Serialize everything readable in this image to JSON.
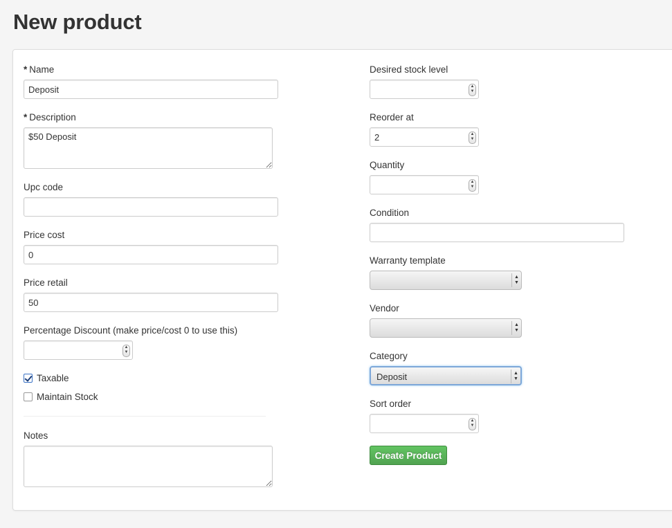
{
  "page": {
    "title": "New product"
  },
  "form": {
    "name": {
      "required_mark": "*",
      "label": "Name",
      "value": "Deposit"
    },
    "description": {
      "required_mark": "*",
      "label": "Description",
      "value": "$50 Deposit"
    },
    "upc_code": {
      "label": "Upc code",
      "value": ""
    },
    "price_cost": {
      "label": "Price cost",
      "value": "0"
    },
    "price_retail": {
      "label": "Price retail",
      "value": "50"
    },
    "percentage_discount": {
      "label": "Percentage Discount (make price/cost 0 to use this)",
      "value": ""
    },
    "taxable": {
      "label": "Taxable",
      "checked": true
    },
    "maintain_stock": {
      "label": "Maintain Stock",
      "checked": false
    },
    "notes": {
      "label": "Notes",
      "value": ""
    },
    "desired_stock_level": {
      "label": "Desired stock level",
      "value": ""
    },
    "reorder_at": {
      "label": "Reorder at",
      "value": "2"
    },
    "quantity": {
      "label": "Quantity",
      "value": ""
    },
    "condition": {
      "label": "Condition",
      "value": ""
    },
    "warranty_template": {
      "label": "Warranty template",
      "selected": ""
    },
    "vendor": {
      "label": "Vendor",
      "selected": ""
    },
    "category": {
      "label": "Category",
      "selected": "Deposit"
    },
    "sort_order": {
      "label": "Sort order",
      "value": ""
    },
    "submit_label": "Create Product"
  },
  "icons": {
    "spinner": "up-down-spinner-icon",
    "select_arrow": "up-down-arrow-icon",
    "checkmark": "checkmark-icon"
  },
  "colors": {
    "submit_button": "#5bb75b",
    "focus_ring": "#7da7d9",
    "checkbox_check": "#1d3f7a"
  }
}
